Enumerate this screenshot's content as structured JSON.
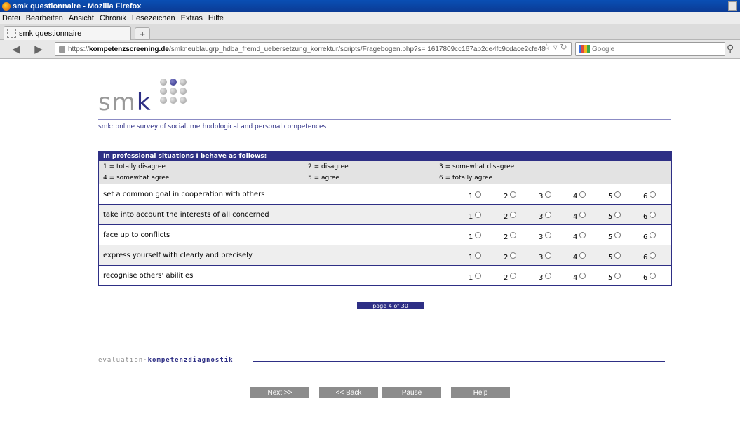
{
  "window": {
    "title": "smk questionnaire - Mozilla Firefox"
  },
  "menu": [
    "Datei",
    "Bearbeiten",
    "Ansicht",
    "Chronik",
    "Lesezeichen",
    "Extras",
    "Hilfe"
  ],
  "tab": {
    "label": "smk questionnaire",
    "new_tab": "+"
  },
  "address": {
    "proto": "https://",
    "host": "kompetenzscreening.de",
    "path": "/smkneublaugrp_hdba_fremd_uebersetzung_korrektur/scripts/Fragebogen.php?s= 1617809cc167ab2ce4fc9cdace2cfe48"
  },
  "search": {
    "placeholder": "Google"
  },
  "logo": {
    "letters": "sm",
    "accent": "k"
  },
  "tagline": "smk: online survey of social, methodological and personal competences",
  "question": {
    "heading": "In professional situations I behave as follows:",
    "legend": [
      "1 = totally disagree",
      "2 = disagree",
      "3 = somewhat disagree",
      "4 = somewhat agree",
      "5 = agree",
      "6 = totally agree"
    ],
    "scale": [
      "1",
      "2",
      "3",
      "4",
      "5",
      "6"
    ],
    "items": [
      "set a common goal in cooperation with others",
      "take into account the interests of all concerned",
      "face up to conflicts",
      "express yourself with clearly and precisely",
      "recognise others' abilities"
    ]
  },
  "page_indicator": "page 4 of 30",
  "footer": {
    "brand_a": "evaluation",
    "sep": "·",
    "brand_b": "kompetenzdiagnostik"
  },
  "buttons": {
    "next": "Next >>",
    "back": "<< Back",
    "pause": "Pause",
    "help": "Help"
  },
  "colors": {
    "brand": "#2e2f85",
    "button": "#8c8c8c"
  }
}
